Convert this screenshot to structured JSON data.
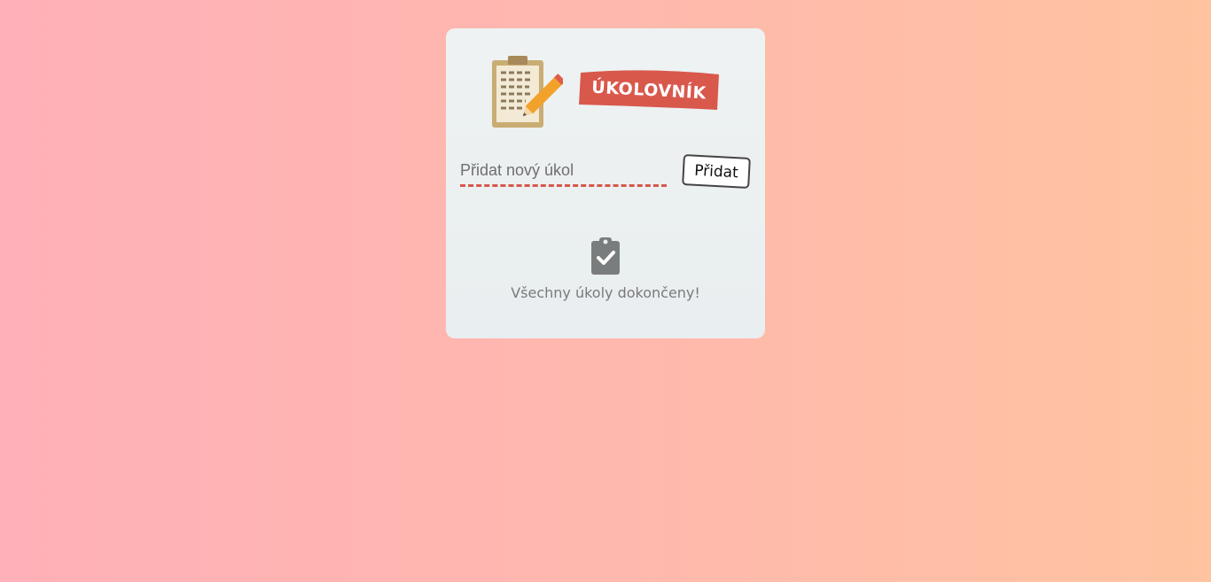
{
  "app": {
    "title": "ÚKOLOVNÍK",
    "logo_icon": "clipboard-pencil-icon",
    "accent_color": "#d9584c"
  },
  "form": {
    "input_placeholder": "Přidat nový úkol",
    "input_value": "",
    "add_button_label": "Přidat"
  },
  "empty_state": {
    "icon": "clipboard-check-icon",
    "message": "Všechny úkoly dokončeny!"
  }
}
